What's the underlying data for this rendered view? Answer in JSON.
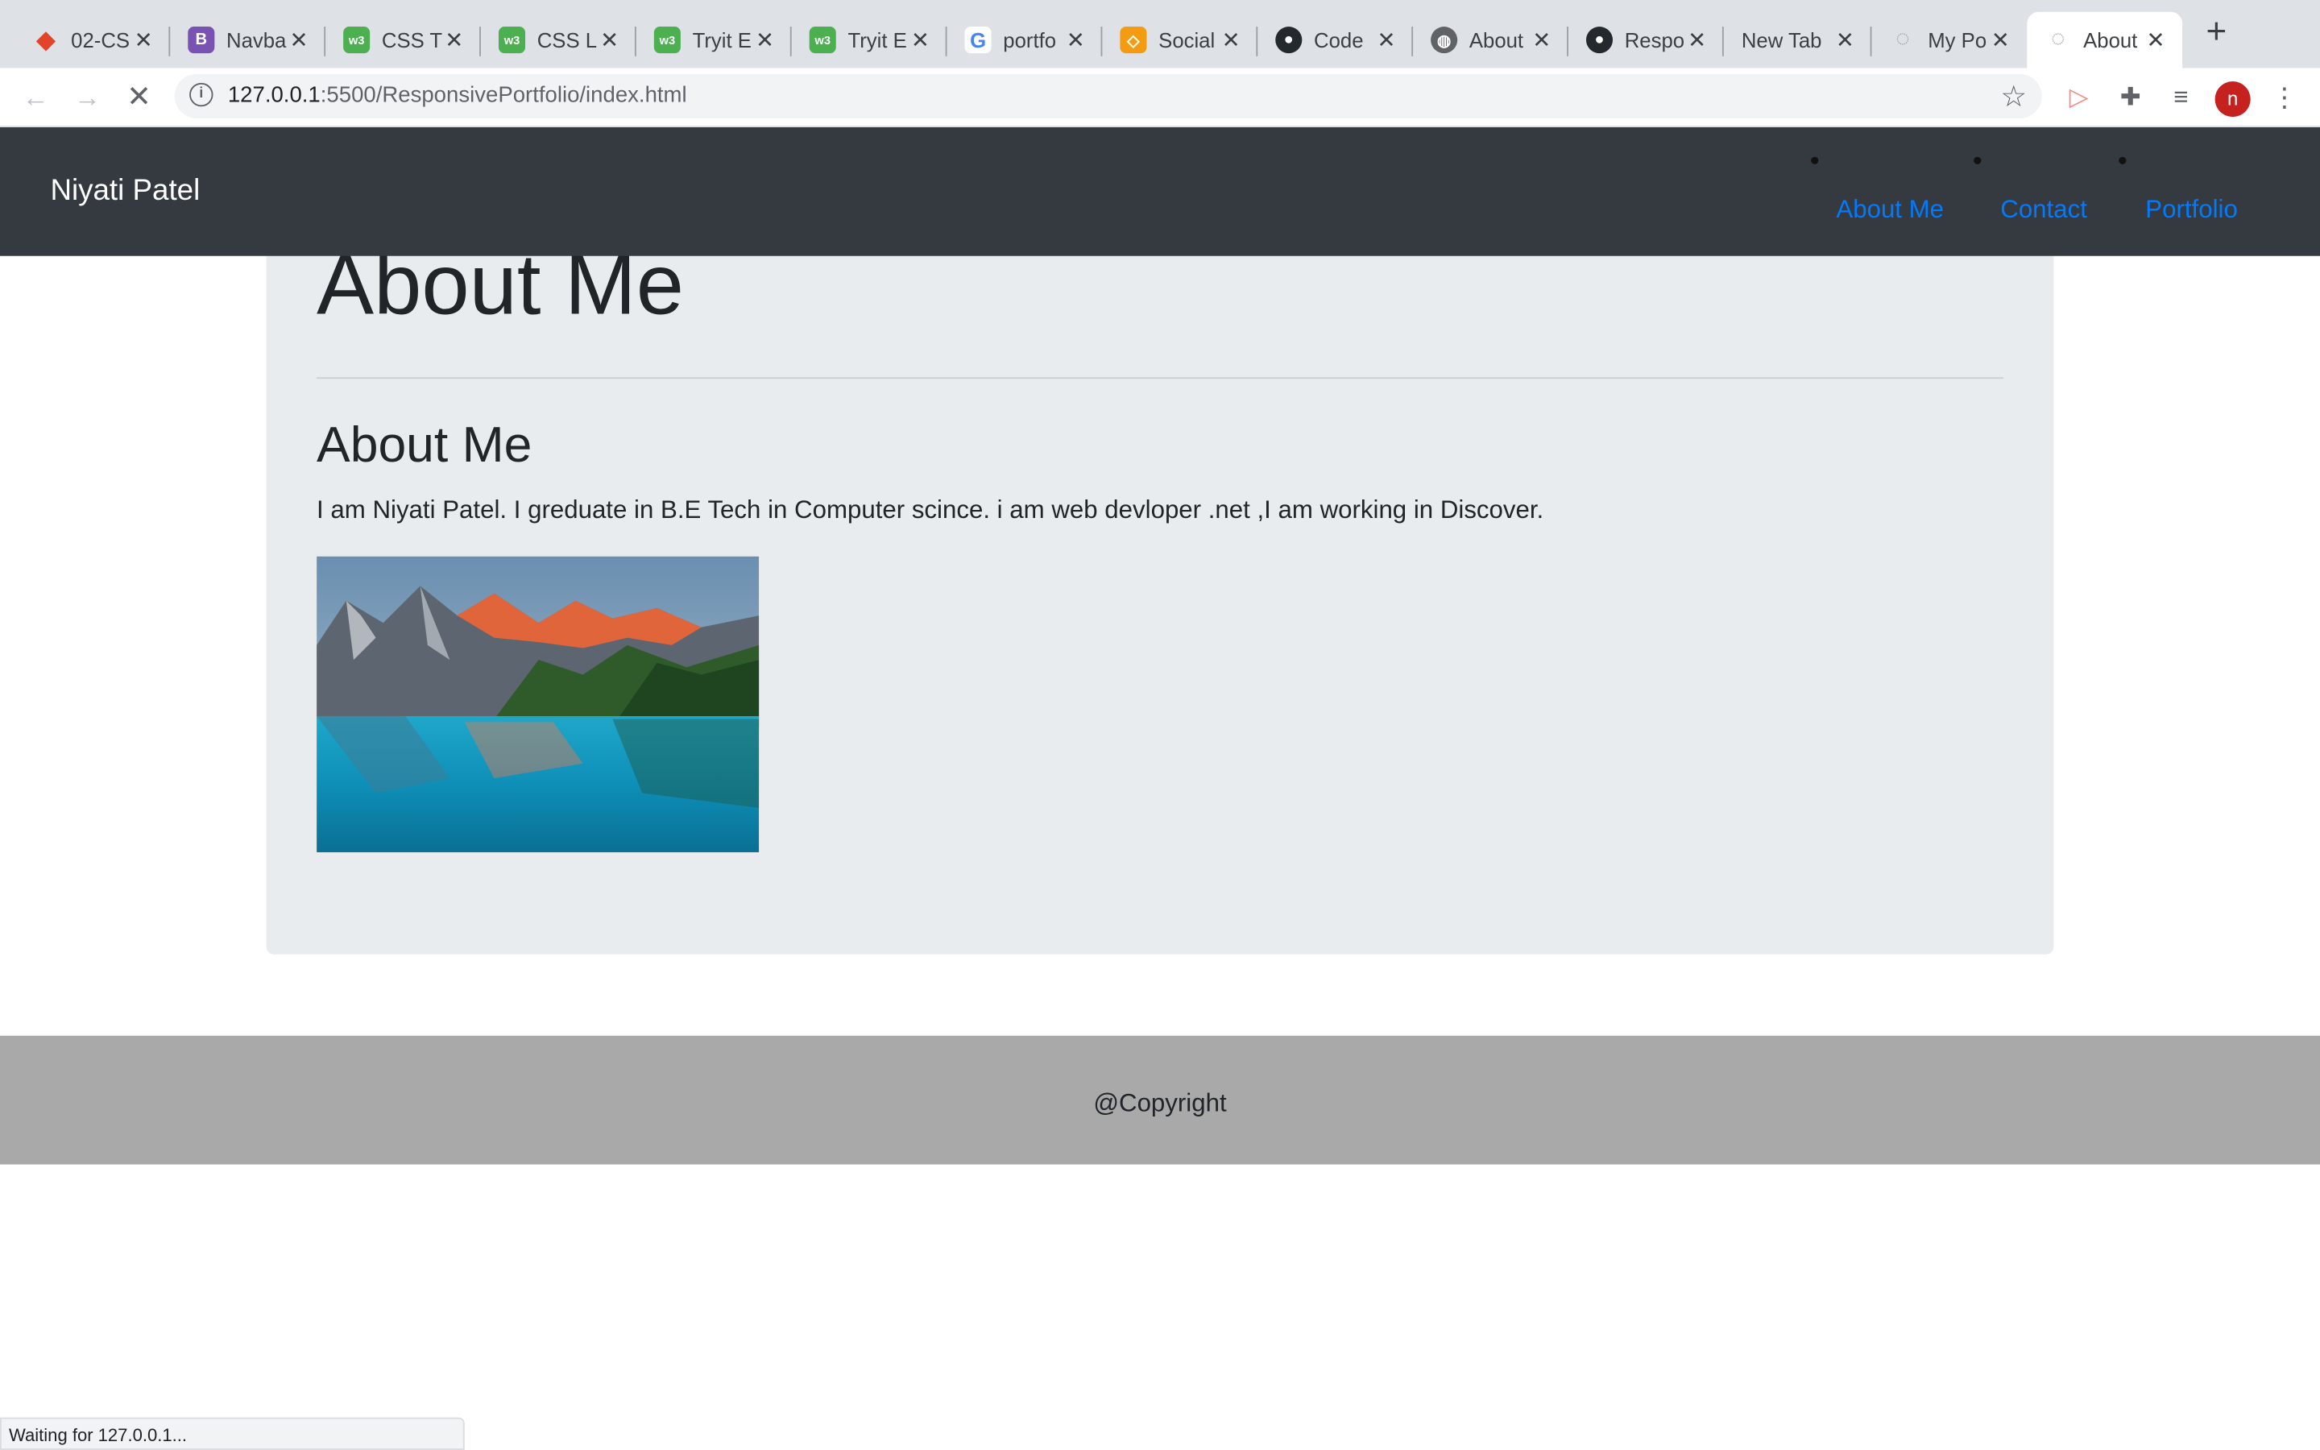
{
  "browser": {
    "tabs": [
      {
        "title": "02-CS",
        "favicon": "gitlab-icon",
        "color": "#e24329"
      },
      {
        "title": "Navbar",
        "favicon": "bootstrap-icon",
        "color": "#7952b3"
      },
      {
        "title": "CSS T",
        "favicon": "w3schools-icon",
        "color": "#4caf50"
      },
      {
        "title": "CSS L",
        "favicon": "w3schools-icon",
        "color": "#4caf50"
      },
      {
        "title": "Tryit E",
        "favicon": "w3schools-icon",
        "color": "#4caf50"
      },
      {
        "title": "Tryit E",
        "favicon": "w3schools-icon",
        "color": "#4caf50"
      },
      {
        "title": "portfo",
        "favicon": "google-icon",
        "color": "#4285f4"
      },
      {
        "title": "Social",
        "favicon": "codepen-style-icon",
        "color": "#f39c12"
      },
      {
        "title": "Code",
        "favicon": "github-icon",
        "color": "#24292e"
      },
      {
        "title": "About",
        "favicon": "globe-icon",
        "color": "#5f6368"
      },
      {
        "title": "Respo",
        "favicon": "github-icon",
        "color": "#24292e"
      },
      {
        "title": "New Tab",
        "favicon": "",
        "color": ""
      },
      {
        "title": "My Po",
        "favicon": "loading-spinner-icon",
        "color": "#9aa0a6"
      },
      {
        "title": "About",
        "favicon": "loading-spinner-icon",
        "color": "#9aa0a6"
      }
    ],
    "active_tab_index": 13,
    "url_host": "127.0.0.1",
    "url_path": ":5500/ResponsivePortfolio/index.html",
    "profile_initial": "n",
    "status_text": "Waiting for 127.0.0.1..."
  },
  "navbar": {
    "brand": "Niyati Patel",
    "links": [
      "About Me",
      "Contact",
      "Portfolio"
    ]
  },
  "jumbotron": {
    "display_heading": "About Me",
    "heading": "About Me",
    "text": "I am Niyati Patel. I greduate in B.E Tech in Computer scince. i am web devloper .net ,I am working in Discover."
  },
  "footer": {
    "text": "@Copyright"
  },
  "colors": {
    "navbar_bg": "#343a40",
    "link": "#007bff",
    "jumbotron_bg": "#e9ecef",
    "footer_bg": "#a9a9a9"
  }
}
